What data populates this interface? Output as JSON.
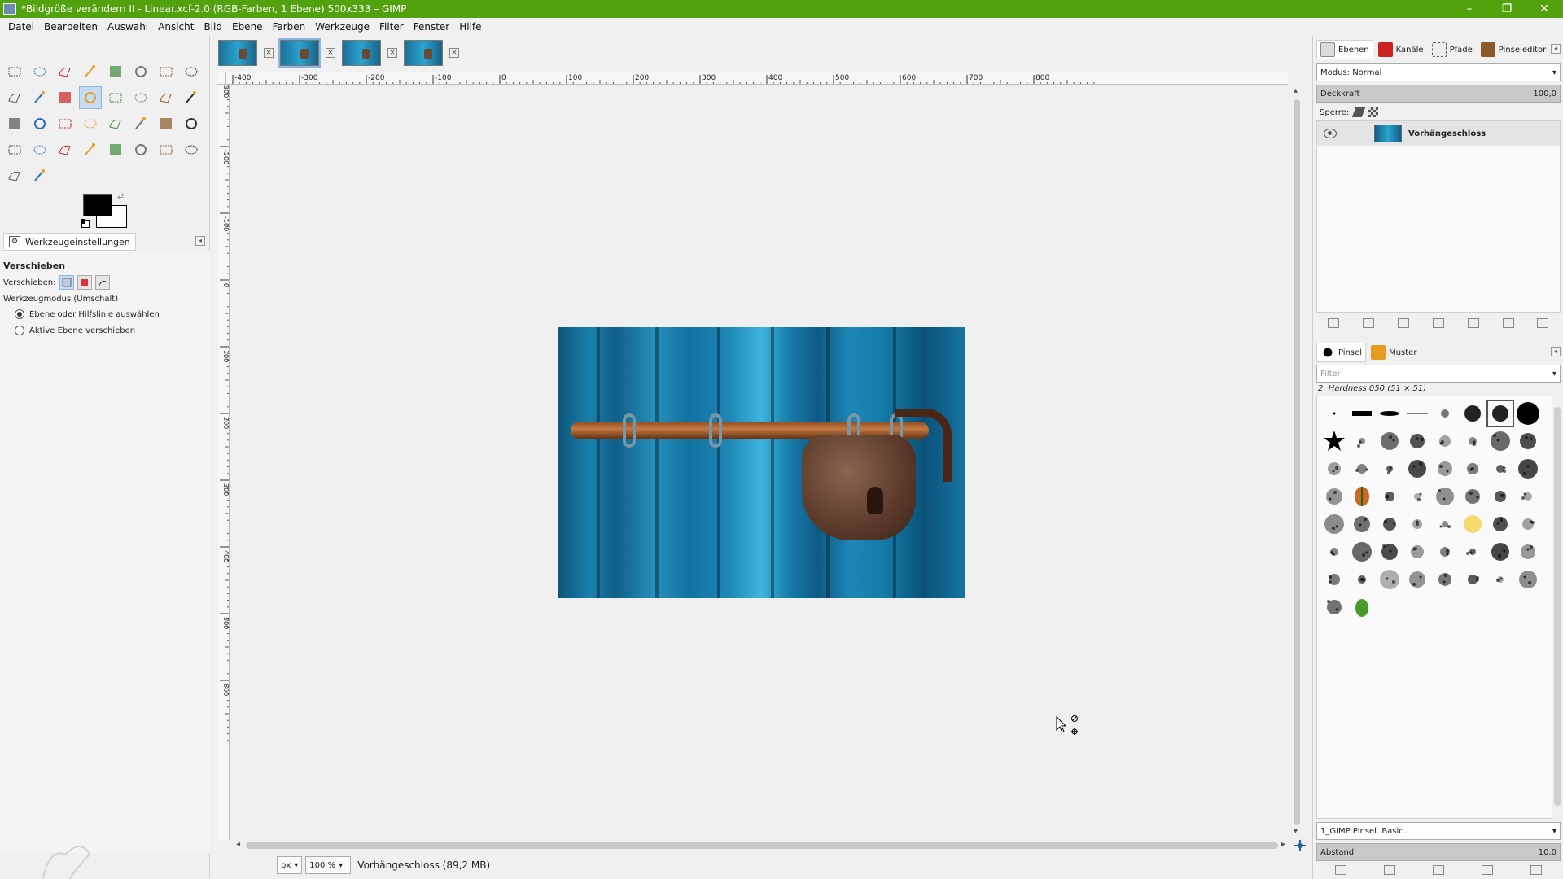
{
  "window": {
    "title": "*Bildgröße verändern II - Linear.xcf-2.0 (RGB-Farben, 1 Ebene) 500x333 – GIMP",
    "minimize": "–",
    "restore": "❐",
    "close": "✕"
  },
  "menubar": [
    "Datei",
    "Bearbeiten",
    "Auswahl",
    "Ansicht",
    "Bild",
    "Ebene",
    "Farben",
    "Werkzeuge",
    "Filter",
    "Fenster",
    "Hilfe"
  ],
  "toolbox": {
    "tool_icons": [
      "rect-select",
      "ellipse-select",
      "free-select",
      "fuzzy-select",
      "select-by-color",
      "scissors-select",
      "foreground-select",
      "paths",
      "color-picker",
      "zoom",
      "measure",
      "move",
      "align",
      "transform",
      "unified-transform",
      "crop",
      "perspective",
      "flip",
      "warp",
      "cage",
      "text",
      "bucket-fill",
      "gradient",
      "pencil",
      "paintbrush",
      "eraser",
      "airbrush",
      "ink",
      "clone",
      "heal",
      "perspective-clone",
      "smudge",
      "dodge-burn",
      "mypaint-brush"
    ]
  },
  "tool_options": {
    "tab_label": "Werkzeugeinstellungen",
    "title": "Verschieben",
    "move_label": "Verschieben:",
    "mode_label": "Werkzeugmodus (Umschalt)",
    "option_1": "Ebene oder Hilfslinie auswählen",
    "option_2": "Aktive Ebene verschieben",
    "selected_option": 1
  },
  "image_tabs": {
    "count": 4,
    "active_index": 1,
    "close_glyph": "×"
  },
  "rulers": {
    "h_labels": [
      "-400",
      "-300",
      "-200",
      "-100",
      "0",
      "100",
      "200",
      "300",
      "400",
      "500",
      "600",
      "700",
      "800"
    ],
    "v_labels": [
      "-300",
      "-200",
      "-100",
      "0",
      "100",
      "200",
      "300",
      "400",
      "500",
      "600"
    ]
  },
  "statusbar": {
    "unit": "px",
    "zoom": "100 %",
    "info": "Vorhängeschloss (89,2 MB)"
  },
  "layers_dock": {
    "tabs": [
      "Ebenen",
      "Kanäle",
      "Pfade",
      "Pinseleditor"
    ],
    "mode": "Modus: Normal",
    "opacity_label": "Deckkraft",
    "opacity_value": "100,0",
    "lock_label": "Sperre:",
    "layers": [
      {
        "name": "Vorhängeschloss",
        "visible": true
      }
    ]
  },
  "brushes_dock": {
    "tabs": [
      "Pinsel",
      "Muster"
    ],
    "filter_placeholder": "Filter",
    "selected_brush": "2. Hardness 050 (51 × 51)",
    "tag": "1_GIMP Pinsel. Basic.",
    "spacing_label": "Abstand",
    "spacing_value": "10,0"
  },
  "colors": {
    "title_bar": "#51a20c",
    "active_tool": "#c6dcf3",
    "foreground": "#000000",
    "background": "#ffffff"
  }
}
